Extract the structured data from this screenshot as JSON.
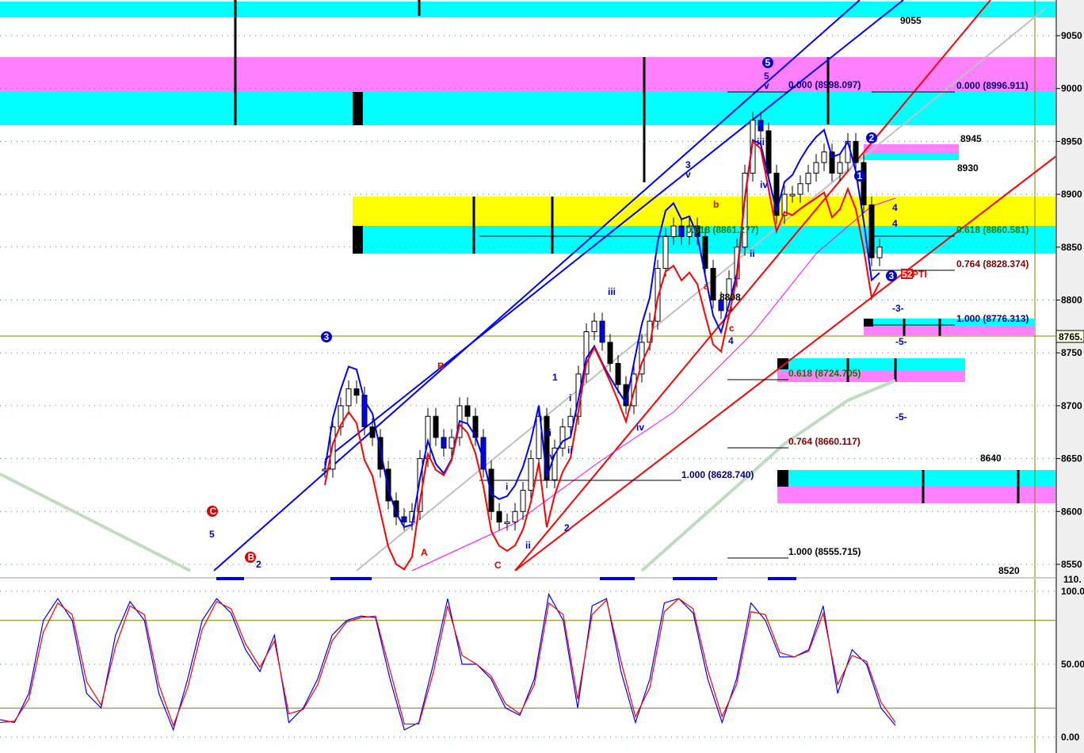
{
  "chart_data": {
    "type": "candlestick",
    "price_panel": {
      "ylim": [
        8540,
        9075
      ],
      "y_ticks": [
        "9050",
        "9000",
        "8950",
        "8900",
        "8850",
        "8800",
        "8750",
        "8700",
        "8650",
        "8600",
        "8550"
      ],
      "last_price_label": "8765.",
      "closes": [
        8640,
        8680,
        8700,
        8716,
        8710,
        8680,
        8670,
        8640,
        8610,
        8595,
        8590,
        8600,
        8650,
        8690,
        8670,
        8660,
        8670,
        8700,
        8690,
        8670,
        8640,
        8600,
        8590,
        8590,
        8600,
        8620,
        8650,
        8690,
        8630,
        8660,
        8680,
        8690,
        8730,
        8770,
        8780,
        8760,
        8740,
        8720,
        8700,
        8730,
        8760,
        8780,
        8830,
        8860,
        8870,
        8860,
        8870,
        8860,
        8830,
        8800,
        8790,
        8820,
        8850,
        8920,
        8970,
        8960,
        8920,
        8880,
        8900,
        8900,
        8910,
        8920,
        8930,
        8940,
        8920,
        8930,
        8950,
        8930,
        8890,
        8840,
        8850
      ]
    },
    "oscillator_panel": {
      "ylim": [
        -5,
        110
      ],
      "y_ticks": [
        "100.0",
        "50.00",
        "0.00"
      ],
      "top_label": "110.",
      "levels": [
        80,
        20
      ],
      "series": [
        {
          "name": "fast",
          "color": "#0000ff",
          "values": [
            12,
            10,
            30,
            80,
            95,
            80,
            30,
            20,
            70,
            93,
            80,
            30,
            5,
            40,
            80,
            95,
            85,
            60,
            45,
            70,
            10,
            20,
            40,
            70,
            80,
            83,
            82,
            40,
            5,
            10,
            50,
            95,
            50,
            50,
            40,
            20,
            15,
            40,
            98,
            80,
            20,
            90,
            95,
            45,
            10,
            40,
            92,
            95,
            85,
            40,
            10,
            40,
            92,
            80,
            55,
            55,
            60,
            90,
            30,
            60,
            50,
            20,
            8
          ]
        },
        {
          "name": "slow",
          "color": "#ff0000",
          "values": [
            10,
            11,
            26,
            72,
            92,
            84,
            38,
            22,
            62,
            90,
            84,
            36,
            8,
            34,
            74,
            93,
            88,
            64,
            48,
            66,
            16,
            19,
            36,
            66,
            79,
            82,
            83,
            46,
            9,
            9,
            44,
            90,
            56,
            50,
            42,
            23,
            16,
            36,
            92,
            84,
            26,
            84,
            94,
            52,
            14,
            34,
            86,
            95,
            88,
            46,
            14,
            36,
            86,
            84,
            58,
            55,
            59,
            85,
            36,
            56,
            52,
            24,
            10
          ]
        }
      ]
    },
    "fib_labels": [
      {
        "text": "0.000 (8998.097)",
        "color": "#000080"
      },
      {
        "text": "0.000 (8996.911)",
        "color": "#000080"
      },
      {
        "text": "0.618 (8860.581)",
        "color": "#008000"
      },
      {
        "text": "0.764 (8828.374)",
        "color": "#800000"
      },
      {
        "text": "1.000 (8776.313)",
        "color": "#000080"
      },
      {
        "text": "0.618 (8724.705)",
        "color": "#008000"
      },
      {
        "text": "0.764 (8660.117)",
        "color": "#800000"
      },
      {
        "text": "1.000 (8628.740)",
        "color": "#000080"
      },
      {
        "text": "1.000 (8555.715)",
        "color": "#000000"
      },
      {
        "text": "0.618 (8861.277)",
        "color": "#008000"
      }
    ],
    "price_notes": [
      "9055",
      "8945",
      "8930",
      "8640",
      "8808",
      "8520"
    ],
    "wave_labels": [
      {
        "text": "5",
        "color": "#0000cc"
      },
      {
        "text": "v",
        "color": "#0000cc"
      },
      {
        "text": "3",
        "color": "#0000cc"
      },
      {
        "text": "v",
        "color": "#0000cc"
      },
      {
        "text": "iii",
        "color": "#0000cc"
      },
      {
        "text": "iv",
        "color": "#0000cc"
      },
      {
        "text": "1",
        "color": "#0000cc"
      },
      {
        "text": "i",
        "color": "#0000cc"
      },
      {
        "text": "iii",
        "color": "#0000cc"
      },
      {
        "text": "iv",
        "color": "#0000cc"
      },
      {
        "text": "ii",
        "color": "#0000cc"
      },
      {
        "text": "2",
        "color": "#0000cc"
      },
      {
        "text": "i",
        "color": "#0000cc"
      },
      {
        "text": "ii",
        "color": "#0000cc"
      },
      {
        "text": "B",
        "color": "#dd0000"
      },
      {
        "text": "A",
        "color": "#dd0000"
      },
      {
        "text": "C",
        "color": "#dd0000"
      },
      {
        "text": "a",
        "color": "#dd0000"
      },
      {
        "text": "b",
        "color": "#dd0000"
      },
      {
        "text": "c",
        "color": "#dd0000"
      },
      {
        "text": "4",
        "color": "#0000cc"
      },
      {
        "text": "iii",
        "color": "#0000cc"
      },
      {
        "text": "iv",
        "color": "#0000cc"
      },
      {
        "text": "ii",
        "color": "#0000cc"
      },
      {
        "text": "-3-",
        "color": "#0000cc"
      },
      {
        "text": "-5-",
        "color": "#0000cc"
      },
      {
        "text": "-5-",
        "color": "#0000cc"
      },
      {
        "text": "5",
        "color": "#0000cc"
      },
      {
        "text": "2",
        "color": "#0000cc"
      },
      {
        "text": "4",
        "color": "#0000cc"
      },
      {
        "text": "4",
        "color": "#0000cc"
      },
      {
        "text": "PTI",
        "color": "#ff0000"
      }
    ],
    "circled_labels": [
      {
        "text": "5",
        "color": "#0000cc"
      },
      {
        "text": "3",
        "color": "#0000cc"
      },
      {
        "text": "1",
        "color": "#0000cc"
      },
      {
        "text": "2",
        "color": "#0000cc"
      },
      {
        "text": "3",
        "color": "#0000cc"
      },
      {
        "text": "C",
        "color": "#dd0000"
      },
      {
        "text": "B",
        "color": "#dd0000"
      }
    ],
    "pti_value": "52",
    "colors": {
      "cyan": "#00ffff",
      "magenta": "#ff80ff",
      "yellow": "#ffff00",
      "ma_green": "#c0dcc0"
    }
  }
}
